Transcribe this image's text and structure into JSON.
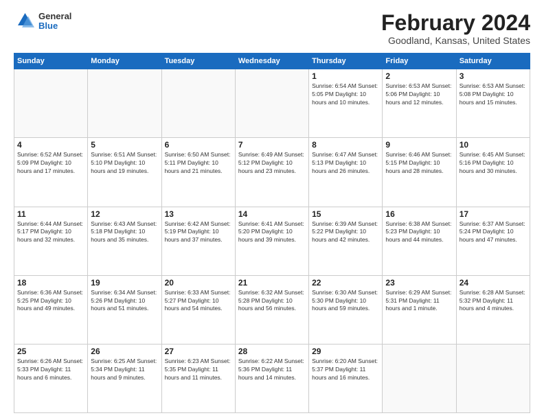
{
  "header": {
    "logo_general": "General",
    "logo_blue": "Blue",
    "main_title": "February 2024",
    "subtitle": "Goodland, Kansas, United States"
  },
  "weekdays": [
    "Sunday",
    "Monday",
    "Tuesday",
    "Wednesday",
    "Thursday",
    "Friday",
    "Saturday"
  ],
  "weeks": [
    [
      {
        "day": "",
        "info": ""
      },
      {
        "day": "",
        "info": ""
      },
      {
        "day": "",
        "info": ""
      },
      {
        "day": "",
        "info": ""
      },
      {
        "day": "1",
        "info": "Sunrise: 6:54 AM\nSunset: 5:05 PM\nDaylight: 10 hours\nand 10 minutes."
      },
      {
        "day": "2",
        "info": "Sunrise: 6:53 AM\nSunset: 5:06 PM\nDaylight: 10 hours\nand 12 minutes."
      },
      {
        "day": "3",
        "info": "Sunrise: 6:53 AM\nSunset: 5:08 PM\nDaylight: 10 hours\nand 15 minutes."
      }
    ],
    [
      {
        "day": "4",
        "info": "Sunrise: 6:52 AM\nSunset: 5:09 PM\nDaylight: 10 hours\nand 17 minutes."
      },
      {
        "day": "5",
        "info": "Sunrise: 6:51 AM\nSunset: 5:10 PM\nDaylight: 10 hours\nand 19 minutes."
      },
      {
        "day": "6",
        "info": "Sunrise: 6:50 AM\nSunset: 5:11 PM\nDaylight: 10 hours\nand 21 minutes."
      },
      {
        "day": "7",
        "info": "Sunrise: 6:49 AM\nSunset: 5:12 PM\nDaylight: 10 hours\nand 23 minutes."
      },
      {
        "day": "8",
        "info": "Sunrise: 6:47 AM\nSunset: 5:13 PM\nDaylight: 10 hours\nand 26 minutes."
      },
      {
        "day": "9",
        "info": "Sunrise: 6:46 AM\nSunset: 5:15 PM\nDaylight: 10 hours\nand 28 minutes."
      },
      {
        "day": "10",
        "info": "Sunrise: 6:45 AM\nSunset: 5:16 PM\nDaylight: 10 hours\nand 30 minutes."
      }
    ],
    [
      {
        "day": "11",
        "info": "Sunrise: 6:44 AM\nSunset: 5:17 PM\nDaylight: 10 hours\nand 32 minutes."
      },
      {
        "day": "12",
        "info": "Sunrise: 6:43 AM\nSunset: 5:18 PM\nDaylight: 10 hours\nand 35 minutes."
      },
      {
        "day": "13",
        "info": "Sunrise: 6:42 AM\nSunset: 5:19 PM\nDaylight: 10 hours\nand 37 minutes."
      },
      {
        "day": "14",
        "info": "Sunrise: 6:41 AM\nSunset: 5:20 PM\nDaylight: 10 hours\nand 39 minutes."
      },
      {
        "day": "15",
        "info": "Sunrise: 6:39 AM\nSunset: 5:22 PM\nDaylight: 10 hours\nand 42 minutes."
      },
      {
        "day": "16",
        "info": "Sunrise: 6:38 AM\nSunset: 5:23 PM\nDaylight: 10 hours\nand 44 minutes."
      },
      {
        "day": "17",
        "info": "Sunrise: 6:37 AM\nSunset: 5:24 PM\nDaylight: 10 hours\nand 47 minutes."
      }
    ],
    [
      {
        "day": "18",
        "info": "Sunrise: 6:36 AM\nSunset: 5:25 PM\nDaylight: 10 hours\nand 49 minutes."
      },
      {
        "day": "19",
        "info": "Sunrise: 6:34 AM\nSunset: 5:26 PM\nDaylight: 10 hours\nand 51 minutes."
      },
      {
        "day": "20",
        "info": "Sunrise: 6:33 AM\nSunset: 5:27 PM\nDaylight: 10 hours\nand 54 minutes."
      },
      {
        "day": "21",
        "info": "Sunrise: 6:32 AM\nSunset: 5:28 PM\nDaylight: 10 hours\nand 56 minutes."
      },
      {
        "day": "22",
        "info": "Sunrise: 6:30 AM\nSunset: 5:30 PM\nDaylight: 10 hours\nand 59 minutes."
      },
      {
        "day": "23",
        "info": "Sunrise: 6:29 AM\nSunset: 5:31 PM\nDaylight: 11 hours\nand 1 minute."
      },
      {
        "day": "24",
        "info": "Sunrise: 6:28 AM\nSunset: 5:32 PM\nDaylight: 11 hours\nand 4 minutes."
      }
    ],
    [
      {
        "day": "25",
        "info": "Sunrise: 6:26 AM\nSunset: 5:33 PM\nDaylight: 11 hours\nand 6 minutes."
      },
      {
        "day": "26",
        "info": "Sunrise: 6:25 AM\nSunset: 5:34 PM\nDaylight: 11 hours\nand 9 minutes."
      },
      {
        "day": "27",
        "info": "Sunrise: 6:23 AM\nSunset: 5:35 PM\nDaylight: 11 hours\nand 11 minutes."
      },
      {
        "day": "28",
        "info": "Sunrise: 6:22 AM\nSunset: 5:36 PM\nDaylight: 11 hours\nand 14 minutes."
      },
      {
        "day": "29",
        "info": "Sunrise: 6:20 AM\nSunset: 5:37 PM\nDaylight: 11 hours\nand 16 minutes."
      },
      {
        "day": "",
        "info": ""
      },
      {
        "day": "",
        "info": ""
      }
    ]
  ]
}
